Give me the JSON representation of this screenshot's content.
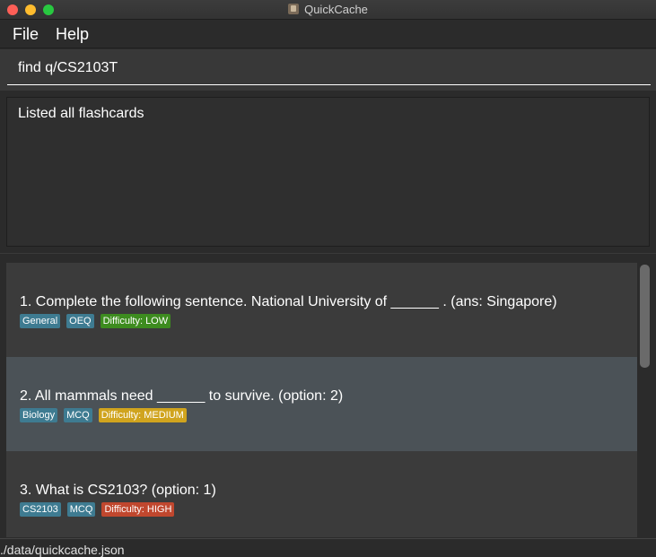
{
  "window": {
    "title": "QuickCache"
  },
  "menu": {
    "file": "File",
    "help": "Help"
  },
  "command": {
    "value": "find q/CS2103T"
  },
  "result": {
    "text": "Listed all flashcards"
  },
  "cards": [
    {
      "title": "1.  Complete the following sentence. National University of ______ . (ans: Singapore)",
      "tags": [
        "General",
        "OEQ"
      ],
      "difficulty": "Difficulty: LOW"
    },
    {
      "title": "2.  All mammals need ______ to survive. (option: 2)",
      "tags": [
        "Biology",
        "MCQ"
      ],
      "difficulty": "Difficulty: MEDIUM"
    },
    {
      "title": "3.  What is CS2103? (option: 1)",
      "tags": [
        "CS2103",
        "MCQ"
      ],
      "difficulty": "Difficulty: HIGH"
    }
  ],
  "status": {
    "path": "./data/quickcache.json"
  },
  "colors": {
    "tag": "#3e7b91",
    "low": "#3d8c1f",
    "medium": "#d0a41e",
    "high": "#c0472e",
    "selected_row": "#4b5257"
  }
}
